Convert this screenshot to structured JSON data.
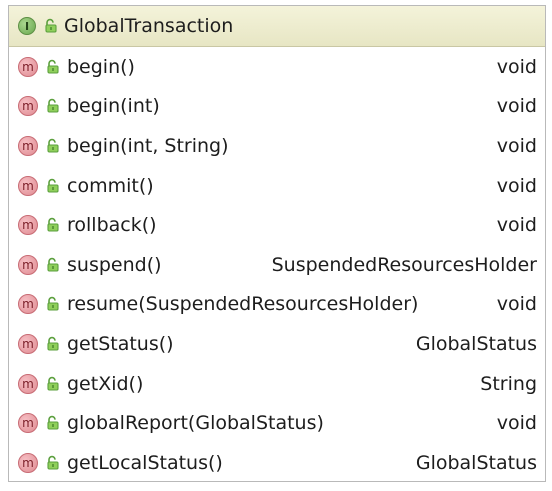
{
  "class": {
    "icon_glyph": "I",
    "method_icon_glyph": "m",
    "name": "GlobalTransaction",
    "methods": [
      {
        "signature": "begin()",
        "return_type": "void"
      },
      {
        "signature": "begin(int)",
        "return_type": "void"
      },
      {
        "signature": "begin(int, String)",
        "return_type": "void"
      },
      {
        "signature": "commit()",
        "return_type": "void"
      },
      {
        "signature": "rollback()",
        "return_type": "void"
      },
      {
        "signature": "suspend()",
        "return_type": "SuspendedResourcesHolder"
      },
      {
        "signature": "resume(SuspendedResourcesHolder)",
        "return_type": "void"
      },
      {
        "signature": "getStatus()",
        "return_type": "GlobalStatus"
      },
      {
        "signature": "getXid()",
        "return_type": "String"
      },
      {
        "signature": "globalReport(GlobalStatus)",
        "return_type": "void"
      },
      {
        "signature": "getLocalStatus()",
        "return_type": "GlobalStatus"
      }
    ]
  },
  "colors": {
    "header_background": "#eeedcf",
    "interface_icon": "#7fb85f",
    "method_icon": "#e89aa0",
    "public_lock": "#5b9f3d"
  },
  "icons": {
    "class_kind": "interface-icon",
    "method_kind": "method-icon",
    "visibility": "public-icon"
  }
}
